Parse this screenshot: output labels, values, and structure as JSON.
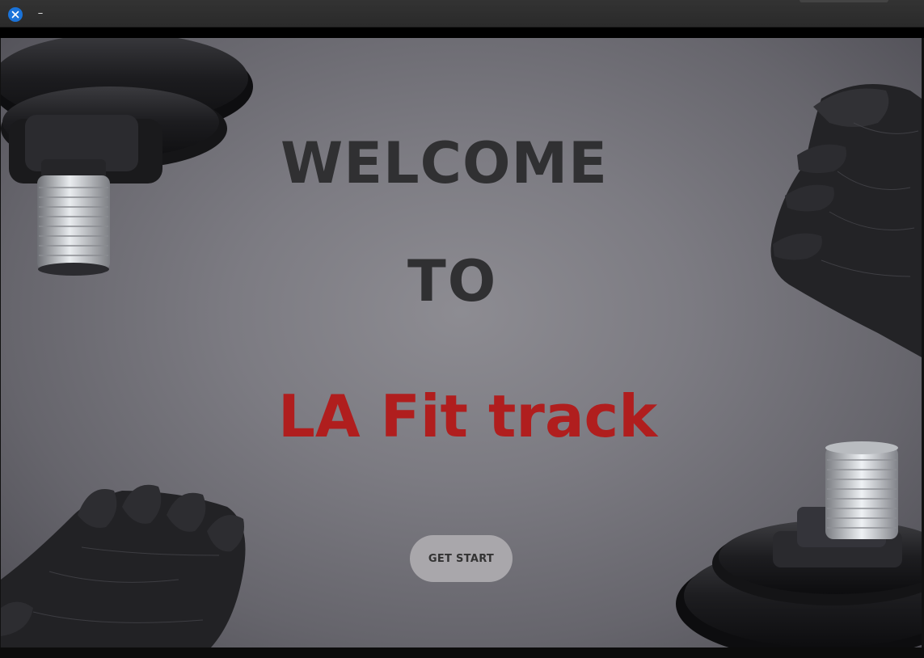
{
  "titlebar": {
    "close_icon": "close-icon",
    "minimize_label": "–"
  },
  "hero": {
    "line1": "WELCOME",
    "line2": "TO",
    "brand": "LA Fit track"
  },
  "actions": {
    "get_start_label": "GET START"
  },
  "colors": {
    "brand": "#b01e1e",
    "heading": "#303032",
    "button_bg": "#a9a7ab",
    "close_button": "#1a73d9"
  },
  "background": {
    "decorations": [
      "weight-plate-top-left",
      "glove-top-right",
      "glove-bottom-left",
      "weight-plate-bottom-right"
    ]
  }
}
